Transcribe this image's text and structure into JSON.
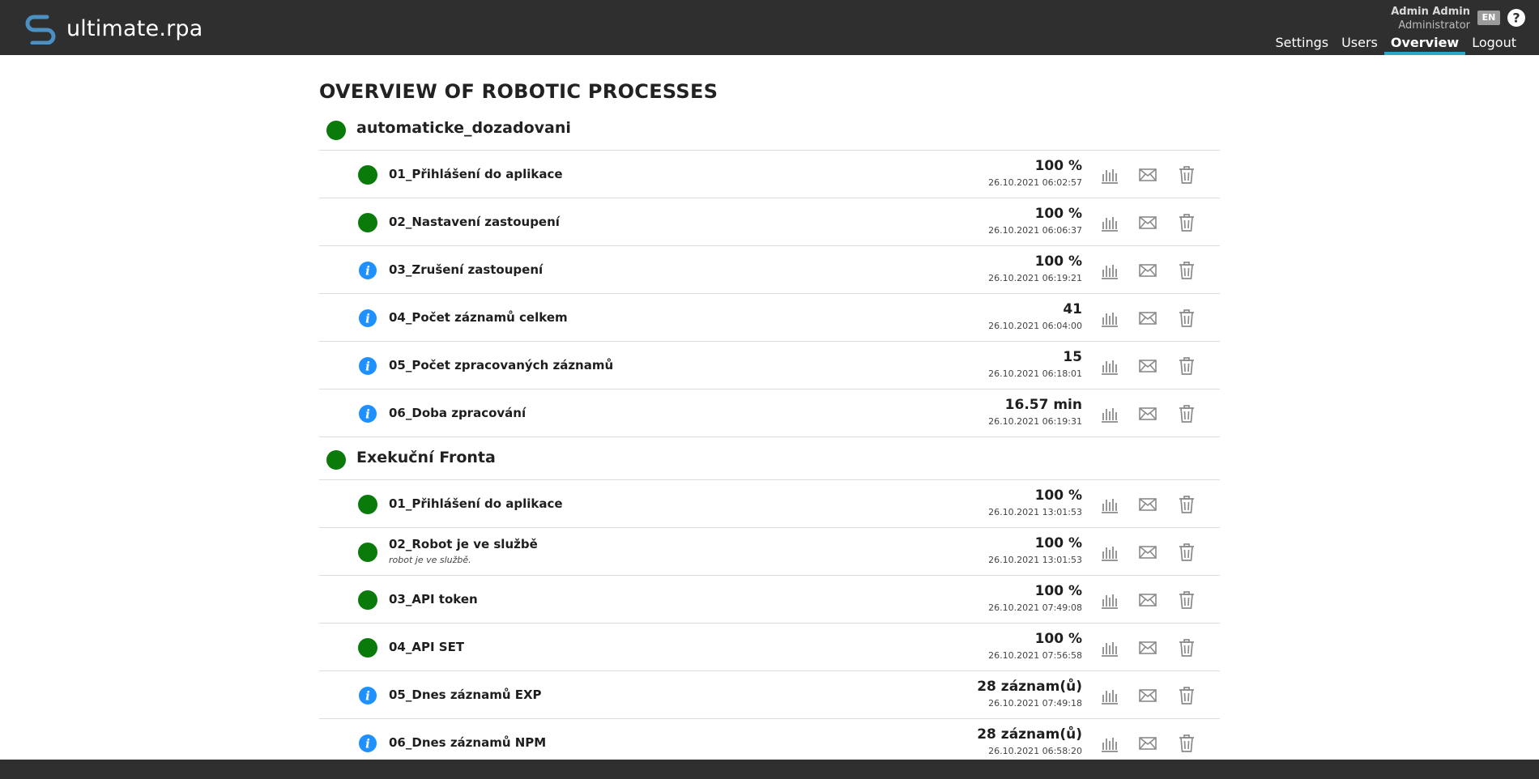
{
  "header": {
    "brand": "ultimate.rpa",
    "user_name": "Admin Admin",
    "user_role": "Administrator",
    "language": "EN",
    "nav": [
      {
        "label": "Settings",
        "active": false
      },
      {
        "label": "Users",
        "active": false
      },
      {
        "label": "Overview",
        "active": true
      },
      {
        "label": "Logout",
        "active": false
      }
    ]
  },
  "page_title": "OVERVIEW OF ROBOTIC PROCESSES",
  "colors": {
    "header_bg": "#2f2f2f",
    "accent": "#2aa7c9",
    "status_ok": "#0a7a0a",
    "status_info": "#1e90ff"
  },
  "groups": [
    {
      "name": "automaticke_dozadovani",
      "status": "ok",
      "rows": [
        {
          "title": "01_Přihlášení do aplikace",
          "value": "100 %",
          "time": "26.10.2021 06:02:57",
          "status": "ok"
        },
        {
          "title": "02_Nastavení zastoupení",
          "value": "100 %",
          "time": "26.10.2021 06:06:37",
          "status": "ok"
        },
        {
          "title": "03_Zrušení zastoupení",
          "value": "100 %",
          "time": "26.10.2021 06:19:21",
          "status": "info"
        },
        {
          "title": "04_Počet záznamů celkem",
          "value": "41",
          "time": "26.10.2021 06:04:00",
          "status": "info"
        },
        {
          "title": "05_Počet zpracovaných záznamů",
          "value": "15",
          "time": "26.10.2021 06:18:01",
          "status": "info"
        },
        {
          "title": "06_Doba zpracování",
          "value": "16.57 min",
          "time": "26.10.2021 06:19:31",
          "status": "info"
        }
      ]
    },
    {
      "name": "Exekuční Fronta",
      "status": "ok",
      "rows": [
        {
          "title": "01_Přihlášení do aplikace",
          "value": "100 %",
          "time": "26.10.2021 13:01:53",
          "status": "ok"
        },
        {
          "title": "02_Robot je ve službě",
          "subtitle": "robot je ve službě.",
          "value": "100 %",
          "time": "26.10.2021 13:01:53",
          "status": "ok"
        },
        {
          "title": "03_API token",
          "value": "100 %",
          "time": "26.10.2021 07:49:08",
          "status": "ok"
        },
        {
          "title": "04_API  SET",
          "value": "100 %",
          "time": "26.10.2021 07:56:58",
          "status": "ok"
        },
        {
          "title": "05_Dnes záznamů EXP",
          "value": "28 záznam(ů)",
          "time": "26.10.2021 07:49:18",
          "status": "info"
        },
        {
          "title": "06_Dnes záznamů NPM",
          "value": "28 záznam(ů)",
          "time": "26.10.2021 06:58:20",
          "status": "info"
        }
      ]
    }
  ]
}
